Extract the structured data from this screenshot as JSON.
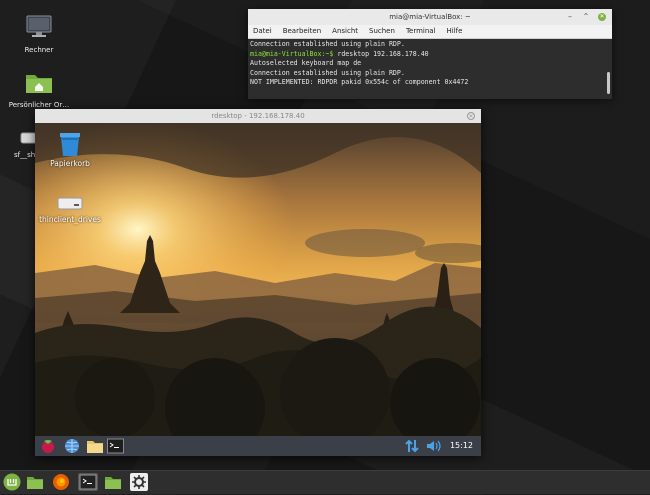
{
  "desktop": {
    "icons": [
      {
        "label": "Rechner",
        "icon": "monitor-icon"
      },
      {
        "label": "Persönlicher Or…",
        "icon": "home-folder-icon"
      },
      {
        "label": "sf__sh…",
        "icon": "drive-icon"
      }
    ]
  },
  "terminal": {
    "title": "mia@mia-VirtualBox: ~",
    "menu": [
      "Datei",
      "Bearbeiten",
      "Ansicht",
      "Suchen",
      "Terminal",
      "Hilfe"
    ],
    "lines": [
      {
        "text": "Connection established using plain RDP."
      },
      {
        "prompt": "mia@mia-VirtualBox:~$",
        "text": " rdesktop 192.168.178.40"
      },
      {
        "text": "Autoselected keyboard map de"
      },
      {
        "text": "Connection established using plain RDP."
      },
      {
        "text": "NOT IMPLEMENTED: RDPDR pakid 0x554c of component 0x4472"
      }
    ]
  },
  "rdesktop": {
    "title": "rdesktop - 192.168.178.40",
    "icons": [
      {
        "label": "Papierkorb",
        "icon": "trash-icon"
      },
      {
        "label": "thinclient_drives",
        "icon": "drive-icon"
      }
    ],
    "panel": {
      "clock": "15:12"
    }
  },
  "colors": {
    "terminal_prompt": "#8ae234",
    "mint_green": "#7cb342",
    "rdp_panel": "#3a3f48"
  }
}
